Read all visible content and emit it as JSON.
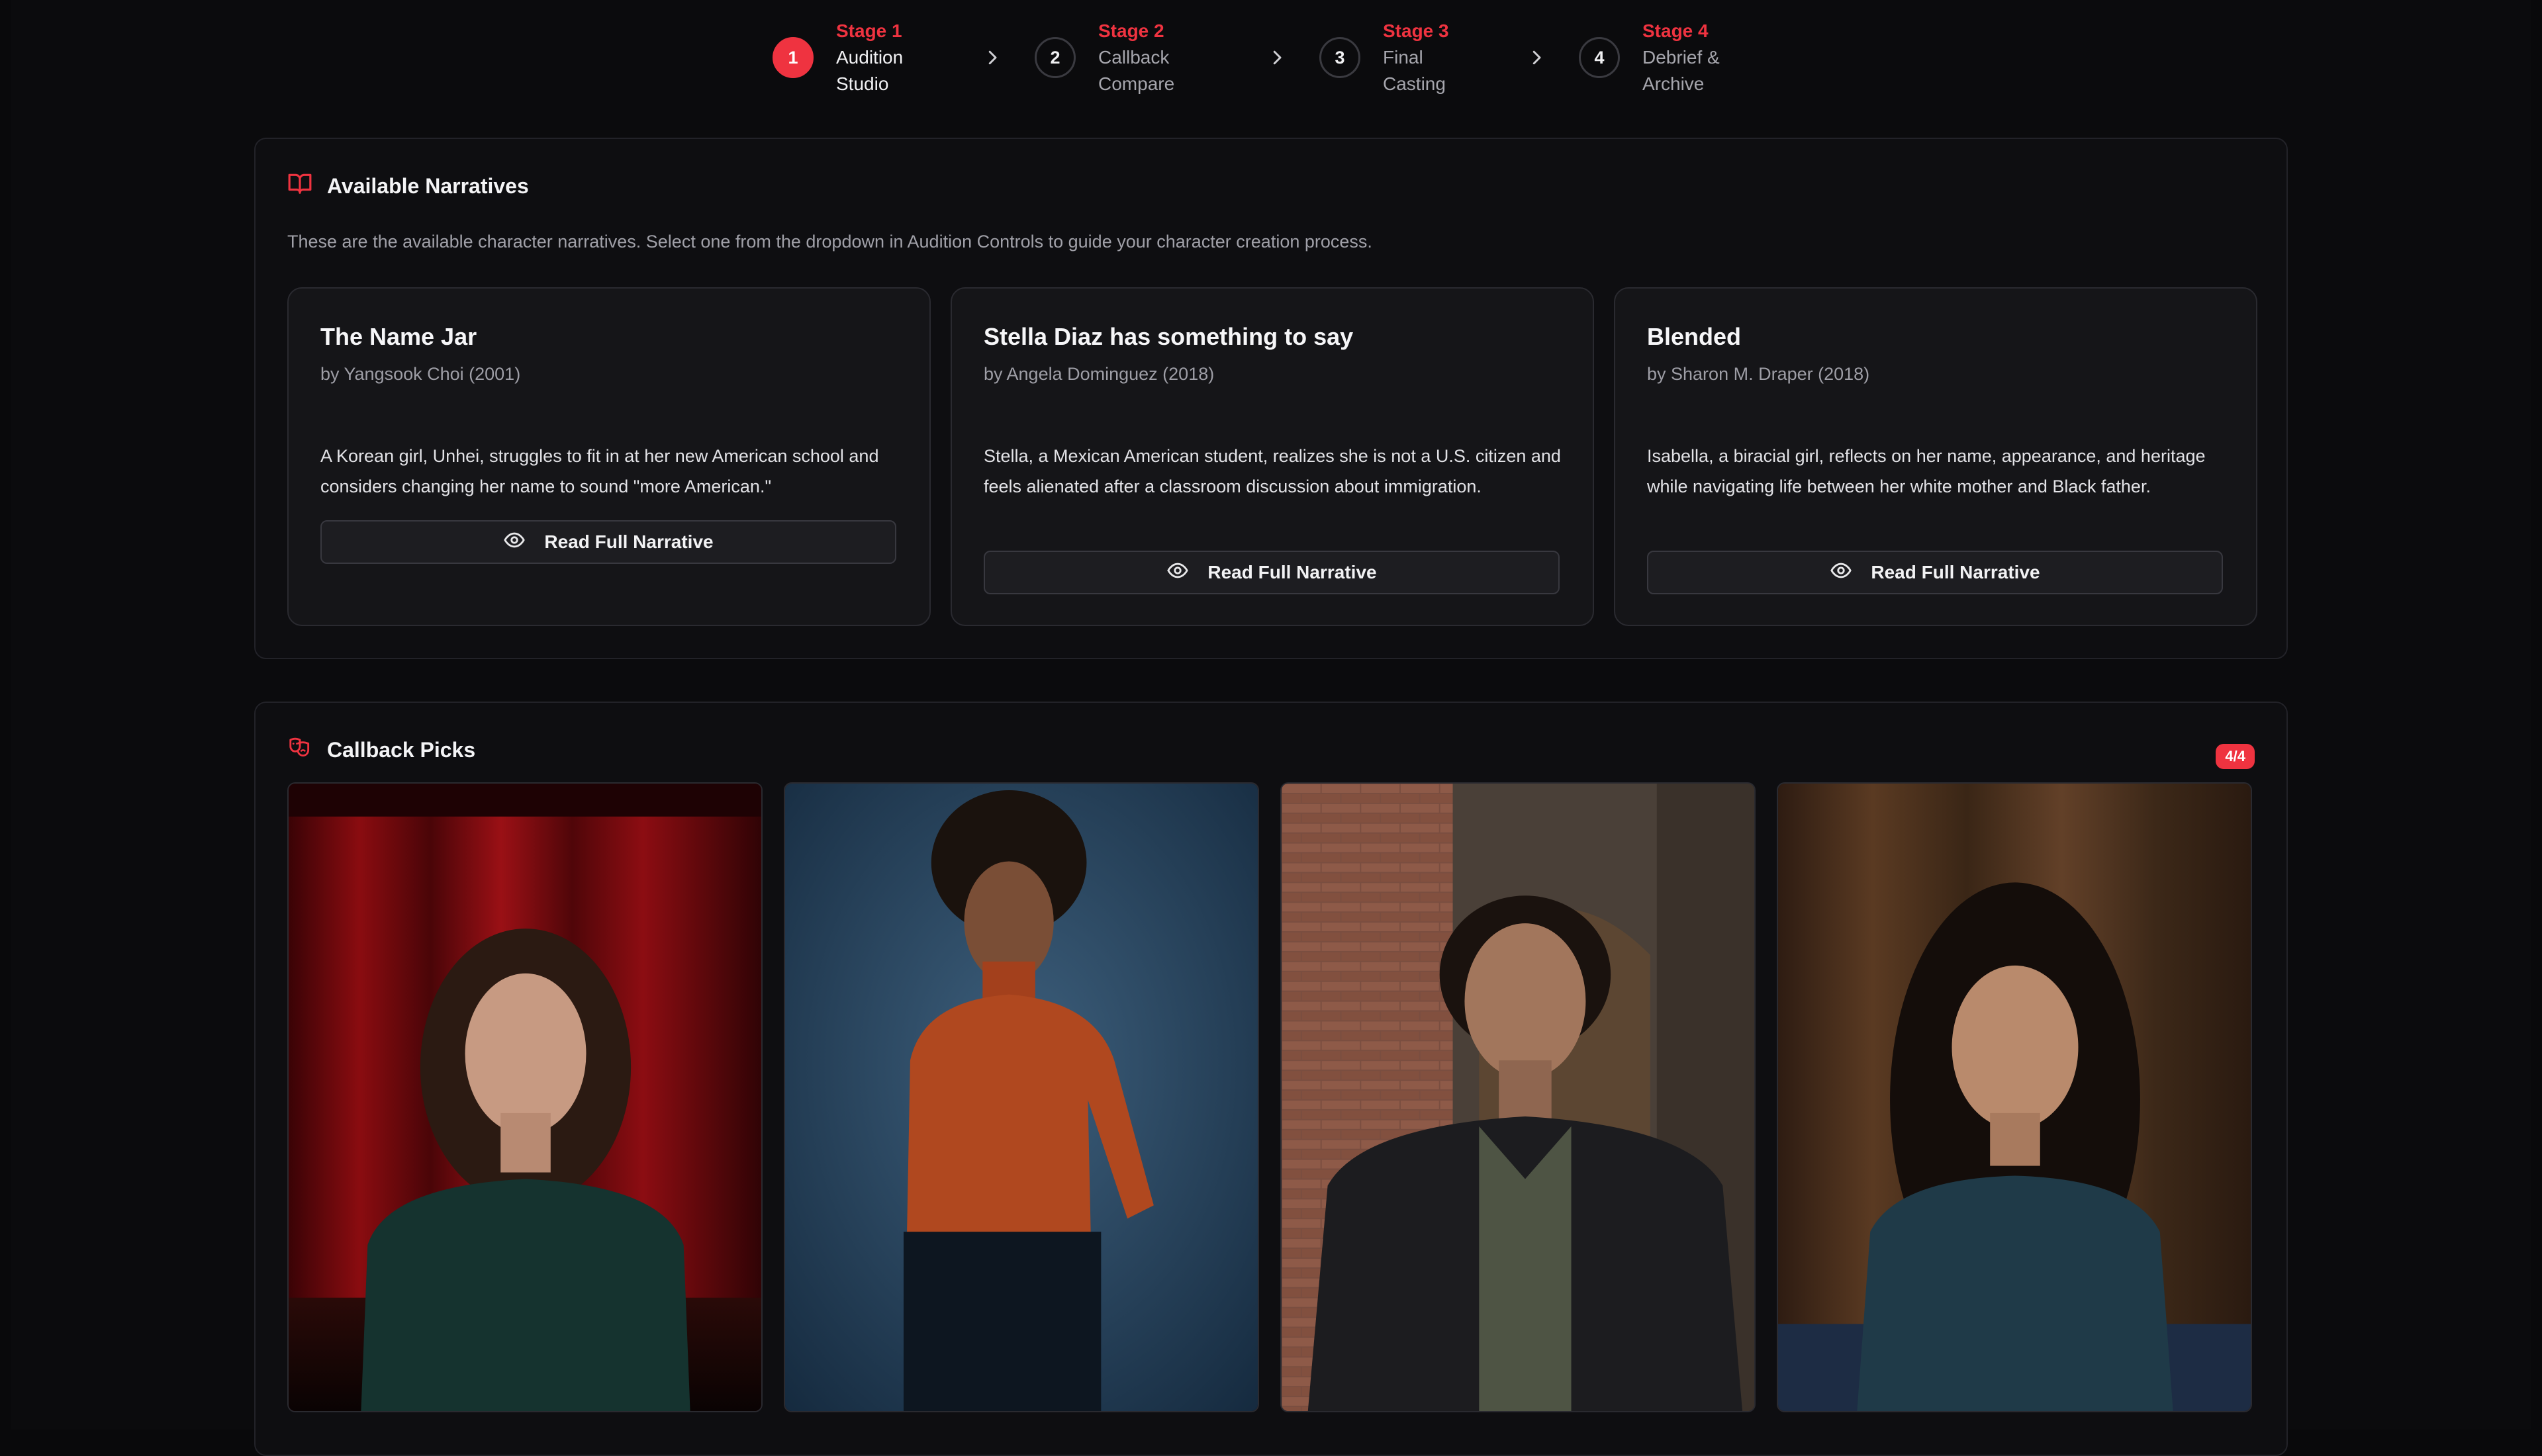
{
  "stepper": {
    "steps": [
      {
        "kicker": "Stage 1",
        "line1": "Audition",
        "line2": "Studio",
        "number": "1"
      },
      {
        "kicker": "Stage 2",
        "line1": "Callback",
        "line2": "Compare",
        "number": "2"
      },
      {
        "kicker": "Stage 3",
        "line1": "Final",
        "line2": "Casting",
        "number": "3"
      },
      {
        "kicker": "Stage 4",
        "line1": "Debrief &",
        "line2": "Archive",
        "number": "4"
      }
    ],
    "active_index": 0
  },
  "narratives_panel": {
    "title": "Available Narratives",
    "icon": "open-book-icon",
    "description": "These are the available character narratives. Select one from the dropdown in Audition Controls to guide your character creation process.",
    "cards": [
      {
        "title": "The Name Jar",
        "author": "by Yangsook Choi (2001)",
        "summary": "A Korean girl, Unhei, struggles to fit in at her new American school and considers changing her name to sound \"more American.\"",
        "button_label": "Read Full Narrative",
        "button_icon": "eye-icon"
      },
      {
        "title": "Stella Diaz has something to say",
        "author": "by Angela Dominguez (2018)",
        "summary": "Stella, a Mexican American student, realizes she is not a U.S. citizen and feels alienated after a classroom discussion about immigration.",
        "button_label": "Read Full Narrative",
        "button_icon": "eye-icon"
      },
      {
        "title": "Blended",
        "author": "by Sharon M. Draper (2018)",
        "summary": "Isabella, a biracial girl, reflects on her name, appearance, and heritage while navigating life between her white mother and Black father.",
        "button_label": "Read Full Narrative",
        "button_icon": "eye-icon"
      }
    ]
  },
  "callback_panel": {
    "title": "Callback Picks",
    "icon": "theater-masks-icon",
    "count_badge": "4/4",
    "picks": [
      {
        "icon": "portrait-photo-red-curtain"
      },
      {
        "icon": "portrait-photo-blue-backdrop"
      },
      {
        "icon": "portrait-photo-brick-wall"
      },
      {
        "icon": "portrait-photo-wood-stage"
      }
    ]
  },
  "colors": {
    "accent": "#ef3340",
    "background": "#0b0b0d",
    "panel": "#0e0e11",
    "card": "#151518"
  }
}
